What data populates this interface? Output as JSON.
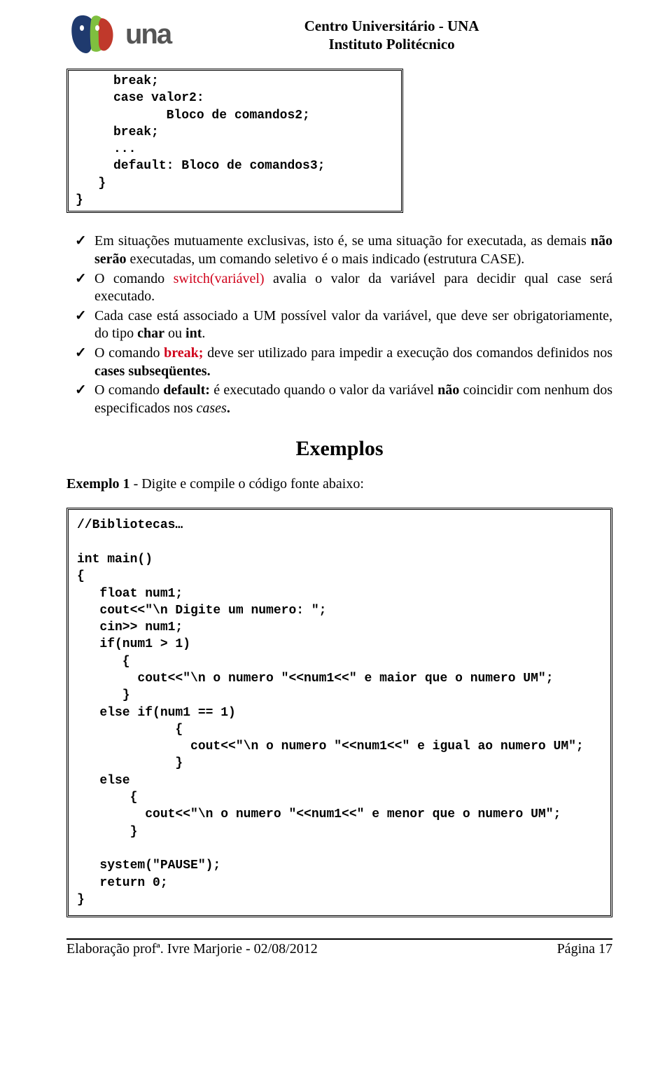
{
  "header": {
    "line1": "Centro Universitário - UNA",
    "line2": "Instituto Politécnico",
    "logo_text": "una"
  },
  "code1": {
    "l1": "     break;",
    "l2": "     case valor2:",
    "l3": "            Bloco de comandos2;",
    "l4": "     break;",
    "l5": "     ...",
    "l6": "     default: Bloco de comandos3;",
    "l7": "   }",
    "l8": "}"
  },
  "bullets": {
    "b1a": "Em situações mutuamente exclusivas, isto é, se uma situação for executada, as demais ",
    "b1b_bold": "não serão",
    "b1c": " executadas, um comando seletivo é o mais indicado (estrutura CASE).",
    "b2a": "O comando ",
    "b2b_red": "switch(variável)",
    "b2c": " avalia o valor da variável para decidir qual case será executado.",
    "b3a": "Cada case está associado a UM possível valor da variável, que deve ser obrigatoriamente, do tipo ",
    "b3b_bold": "char",
    "b3c": " ou ",
    "b3d_bold": "int",
    "b3e": ".",
    "b4a": "O comando ",
    "b4b_redbold": "break;",
    "b4c": " deve ser utilizado para impedir a execução dos comandos definidos nos ",
    "b4d_bold": "cases subseqüentes.",
    "b5a": "O comando ",
    "b5b_bold": "default:",
    "b5c": " é executado quando o valor da variável ",
    "b5d_bold": "não",
    "b5e": " coincidir com nenhum dos especificados nos ",
    "b5f_it": "cases",
    "b5g_bold": "."
  },
  "section_title": "Exemplos",
  "example_line_a": "Exemplo 1",
  "example_line_b": " - Digite e compile o código fonte abaixo:",
  "code2": "//Bibliotecas…\n\nint main()\n{\n   float num1;\n   cout<<\"\\n Digite um numero: \";\n   cin>> num1;\n   if(num1 > 1)\n      {\n        cout<<\"\\n o numero \"<<num1<<\" e maior que o numero UM\";\n      }\n   else if(num1 == 1)\n             {\n               cout<<\"\\n o numero \"<<num1<<\" e igual ao numero UM\";\n             }\n   else\n       {\n         cout<<\"\\n o numero \"<<num1<<\" e menor que o numero UM\";\n       }\n\n   system(\"PAUSE\");\n   return 0;\n}",
  "footer": {
    "left": "Elaboração profª. Ivre Marjorie - 02/08/2012",
    "right": "Página 17"
  }
}
